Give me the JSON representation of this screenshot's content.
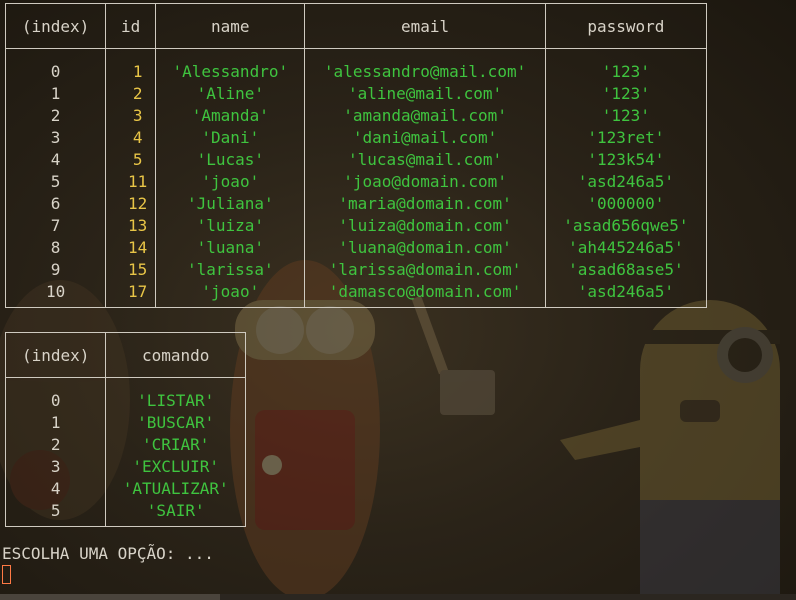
{
  "users_table": {
    "columns": [
      "(index)",
      "id",
      "name",
      "email",
      "password"
    ],
    "rows": [
      {
        "index": "0",
        "id": "1",
        "name": "'Alessandro'",
        "email": "'alessandro@mail.com'",
        "password": "'123'"
      },
      {
        "index": "1",
        "id": "2",
        "name": "'Aline'",
        "email": "'aline@mail.com'",
        "password": "'123'"
      },
      {
        "index": "2",
        "id": "3",
        "name": "'Amanda'",
        "email": "'amanda@mail.com'",
        "password": "'123'"
      },
      {
        "index": "3",
        "id": "4",
        "name": "'Dani'",
        "email": "'dani@mail.com'",
        "password": "'123ret'"
      },
      {
        "index": "4",
        "id": "5",
        "name": "'Lucas'",
        "email": "'lucas@mail.com'",
        "password": "'123k54'"
      },
      {
        "index": "5",
        "id": "11",
        "name": "'joao'",
        "email": "'joao@domain.com'",
        "password": "'asd246a5'"
      },
      {
        "index": "6",
        "id": "12",
        "name": "'Juliana'",
        "email": "'maria@domain.com'",
        "password": "'000000'"
      },
      {
        "index": "7",
        "id": "13",
        "name": "'luiza'",
        "email": "'luiza@domain.com'",
        "password": "'asad656qwe5'"
      },
      {
        "index": "8",
        "id": "14",
        "name": "'luana'",
        "email": "'luana@domain.com'",
        "password": "'ah445246a5'"
      },
      {
        "index": "9",
        "id": "15",
        "name": "'larissa'",
        "email": "'larissa@domain.com'",
        "password": "'asad68ase5'"
      },
      {
        "index": "10",
        "id": "17",
        "name": "'joao'",
        "email": "'damasco@domain.com'",
        "password": "'asd246a5'"
      }
    ]
  },
  "commands_table": {
    "columns": [
      "(index)",
      "comando"
    ],
    "rows": [
      {
        "index": "0",
        "comando": "'LISTAR'"
      },
      {
        "index": "1",
        "comando": "'BUSCAR'"
      },
      {
        "index": "2",
        "comando": "'CRIAR'"
      },
      {
        "index": "3",
        "comando": "'EXCLUIR'"
      },
      {
        "index": "4",
        "comando": "'ATUALIZAR'"
      },
      {
        "index": "5",
        "comando": "'SAIR'"
      }
    ]
  },
  "prompt": "ESCOLHA UMA OPÇÃO: ...",
  "colors": {
    "string": "#3fc43f",
    "number": "#e8c547",
    "text": "#d8d3c8",
    "cursor": "#ff7a45"
  }
}
